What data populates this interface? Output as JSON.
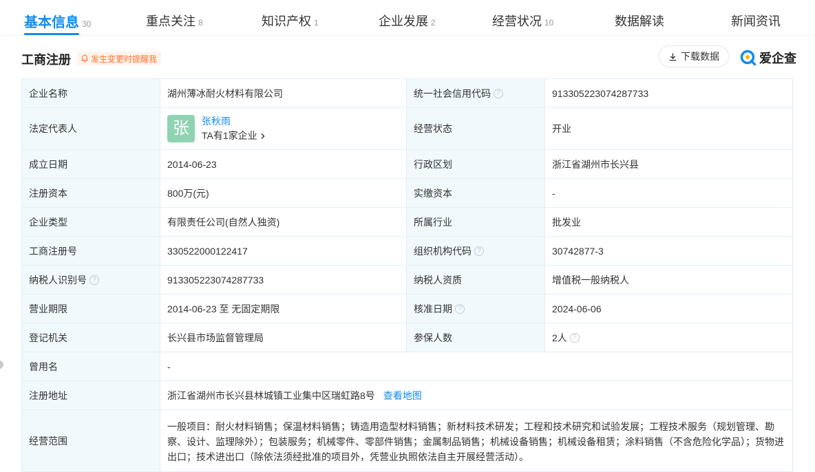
{
  "tabs": [
    {
      "label": "基本信息",
      "count": "30"
    },
    {
      "label": "重点关注",
      "count": "8"
    },
    {
      "label": "知识产权",
      "count": "1"
    },
    {
      "label": "企业发展",
      "count": "2"
    },
    {
      "label": "经营状况",
      "count": "10"
    },
    {
      "label": "数据解读",
      "count": ""
    },
    {
      "label": "新闻资讯",
      "count": ""
    }
  ],
  "section": {
    "title": "工商注册",
    "notify_label": "发生变更时提醒我",
    "download_label": "下载数据",
    "brand_name": "爱企查"
  },
  "fields": {
    "company_name": {
      "label": "企业名称",
      "value": "湖州薄冰耐火材料有限公司"
    },
    "credit_code": {
      "label": "统一社会信用代码",
      "value": "913305223074287733"
    },
    "legal_rep": {
      "label": "法定代表人",
      "avatar_char": "张",
      "name": "张秋雨",
      "sub": "TA有1家企业"
    },
    "status": {
      "label": "经营状态",
      "value": "开业"
    },
    "founded": {
      "label": "成立日期",
      "value": "2014-06-23"
    },
    "region": {
      "label": "行政区划",
      "value": "浙江省湖州市长兴县"
    },
    "reg_capital": {
      "label": "注册资本",
      "value": "800万(元)"
    },
    "paid_capital": {
      "label": "实缴资本",
      "value": "-"
    },
    "company_type": {
      "label": "企业类型",
      "value": "有限责任公司(自然人独资)"
    },
    "industry": {
      "label": "所属行业",
      "value": "批发业"
    },
    "reg_no": {
      "label": "工商注册号",
      "value": "330522000122417"
    },
    "org_code": {
      "label": "组织机构代码",
      "value": "30742877-3"
    },
    "taxpayer_id": {
      "label": "纳税人识别号",
      "value": "913305223074287733"
    },
    "taxpayer_type": {
      "label": "纳税人资质",
      "value": "增值税一般纳税人"
    },
    "term": {
      "label": "营业期限",
      "value": "2014-06-23 至 无固定期限"
    },
    "approval_date": {
      "label": "核准日期",
      "value": "2024-06-06"
    },
    "authority": {
      "label": "登记机关",
      "value": "长兴县市场监督管理局"
    },
    "insured": {
      "label": "参保人数",
      "value": "2人"
    },
    "former_name": {
      "label": "曾用名",
      "value": "-"
    },
    "address": {
      "label": "注册地址",
      "value": "浙江省湖州市长兴县林城镇工业集中区瑞虹路8号",
      "map_link": "查看地图"
    },
    "scope": {
      "label": "经营范围",
      "value": "一般项目：耐火材料销售；保温材料销售；铸造用造型材料销售；新材料技术研发；工程和技术研究和试验发展；工程技术服务（规划管理、勘察、设计、监理除外）；包装服务；机械零件、零部件销售；金属制品销售；机械设备销售；机械设备租赁；涂料销售（不含危险化学品）；货物进出口；技术进出口（除依法须经批准的项目外，凭营业执照依法自主开展经营活动）。"
    }
  },
  "colors": {
    "accent": "#128bed",
    "notify": "#ff722d",
    "label_bg": "#f2f9fc",
    "avatar_bg": "#8fd3b3"
  }
}
